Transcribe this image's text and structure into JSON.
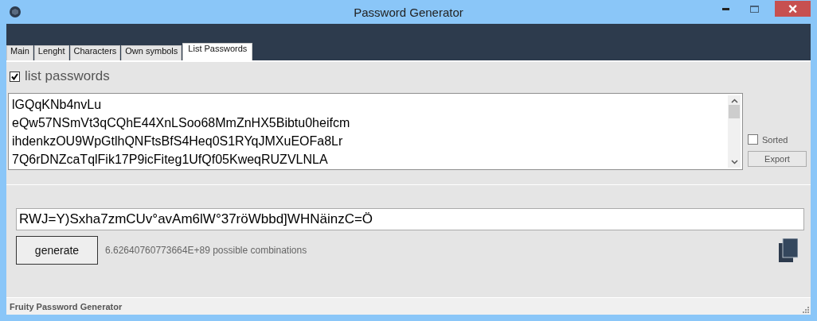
{
  "window": {
    "title": "Password Generator",
    "close": "×"
  },
  "tabs": [
    {
      "label": "Main",
      "selected": false
    },
    {
      "label": "Lenght",
      "selected": false
    },
    {
      "label": "Characters",
      "selected": false
    },
    {
      "label": "Own symbols",
      "selected": false
    },
    {
      "label": "List Passwords",
      "selected": true
    }
  ],
  "list_passwords": {
    "label": "list passwords",
    "checked": true
  },
  "password_list": [
    "lGQqKNb4nvLu",
    "eQw57NSmVt3qCQhE44XnLSoo68MmZnHX5Bibtu0heifcm",
    "ihdenkzOU9WpGtlhQNFtsBfS4Heq0S1RYqJMXuEOFa8Lr",
    "7Q6rDNZcaTqlFik17P9icFiteg1UfQf05KweqRUZVLNLA"
  ],
  "sorted": {
    "label": "Sorted",
    "checked": false
  },
  "export_button": "Export",
  "password": "RWJ=Y)Sxha7zmCUv°avAm6lW°37röWbbd]WHNäinzC=Ö",
  "generate_button": "generate",
  "combinations": "6.62640760773664E+89 possible combinations",
  "status_bar": "Fruity Password Generator"
}
